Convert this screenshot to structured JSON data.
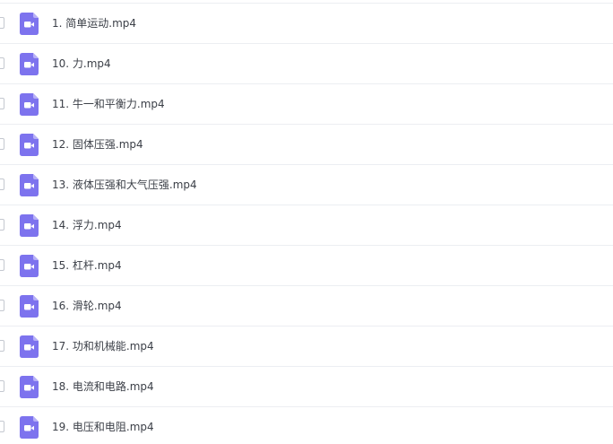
{
  "colors": {
    "icon_fill": "#7d73ee",
    "icon_fold": "#b7b0f7",
    "text": "#3c4048",
    "divider": "#eceef2"
  },
  "icons": {
    "file_type": "video-file-icon",
    "select": "checkbox"
  },
  "files": [
    {
      "name": "1. 简单运动.mp4"
    },
    {
      "name": "10. 力.mp4"
    },
    {
      "name": "11. 牛一和平衡力.mp4"
    },
    {
      "name": "12. 固体压强.mp4"
    },
    {
      "name": "13. 液体压强和大气压强.mp4"
    },
    {
      "name": "14. 浮力.mp4"
    },
    {
      "name": "15. 杠杆.mp4"
    },
    {
      "name": "16. 滑轮.mp4"
    },
    {
      "name": "17. 功和机械能.mp4"
    },
    {
      "name": "18. 电流和电路.mp4"
    },
    {
      "name": "19. 电压和电阻.mp4"
    }
  ]
}
